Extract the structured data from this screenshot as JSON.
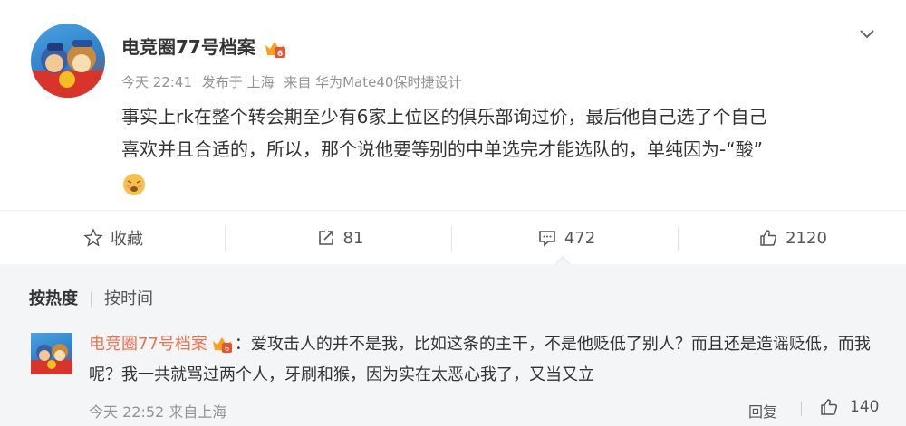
{
  "post": {
    "author": "电竞圈77号档案",
    "meta": {
      "time": "今天 22:41",
      "location": "发布于 上海",
      "source": "来自 华为Mate40保时捷设计"
    },
    "content_line1": "事实上rk在整个转会期至少有6家上位区的俱乐部询过价，最后他自己选了个自己",
    "content_line2": "喜欢并且合适的，所以，那个说他要等别的中单选完才能选队的，单纯因为-“酸”",
    "emoji_icon": "sour-face-emoji"
  },
  "actions": {
    "favorite": "收藏",
    "repost_count": "81",
    "comment_count": "472",
    "like_count": "2120"
  },
  "comments": {
    "sort_hot": "按热度",
    "sort_time": "按时间",
    "items": [
      {
        "author": "电竞圈77号档案",
        "text": "：爱攻击人的并不是我，比如这条的主干，不是他贬低了别人？而且还是造谣贬低，而我呢？我一共就骂过两个人，牙刷和猴，因为实在太恶心我了，又当又立",
        "time": "今天 22:52 来自上海",
        "reply_label": "回复",
        "like_count": "140"
      }
    ]
  },
  "colors": {
    "author_orange": "#eb7350",
    "muted": "#939393",
    "comment_bg": "#f4f5f7"
  }
}
